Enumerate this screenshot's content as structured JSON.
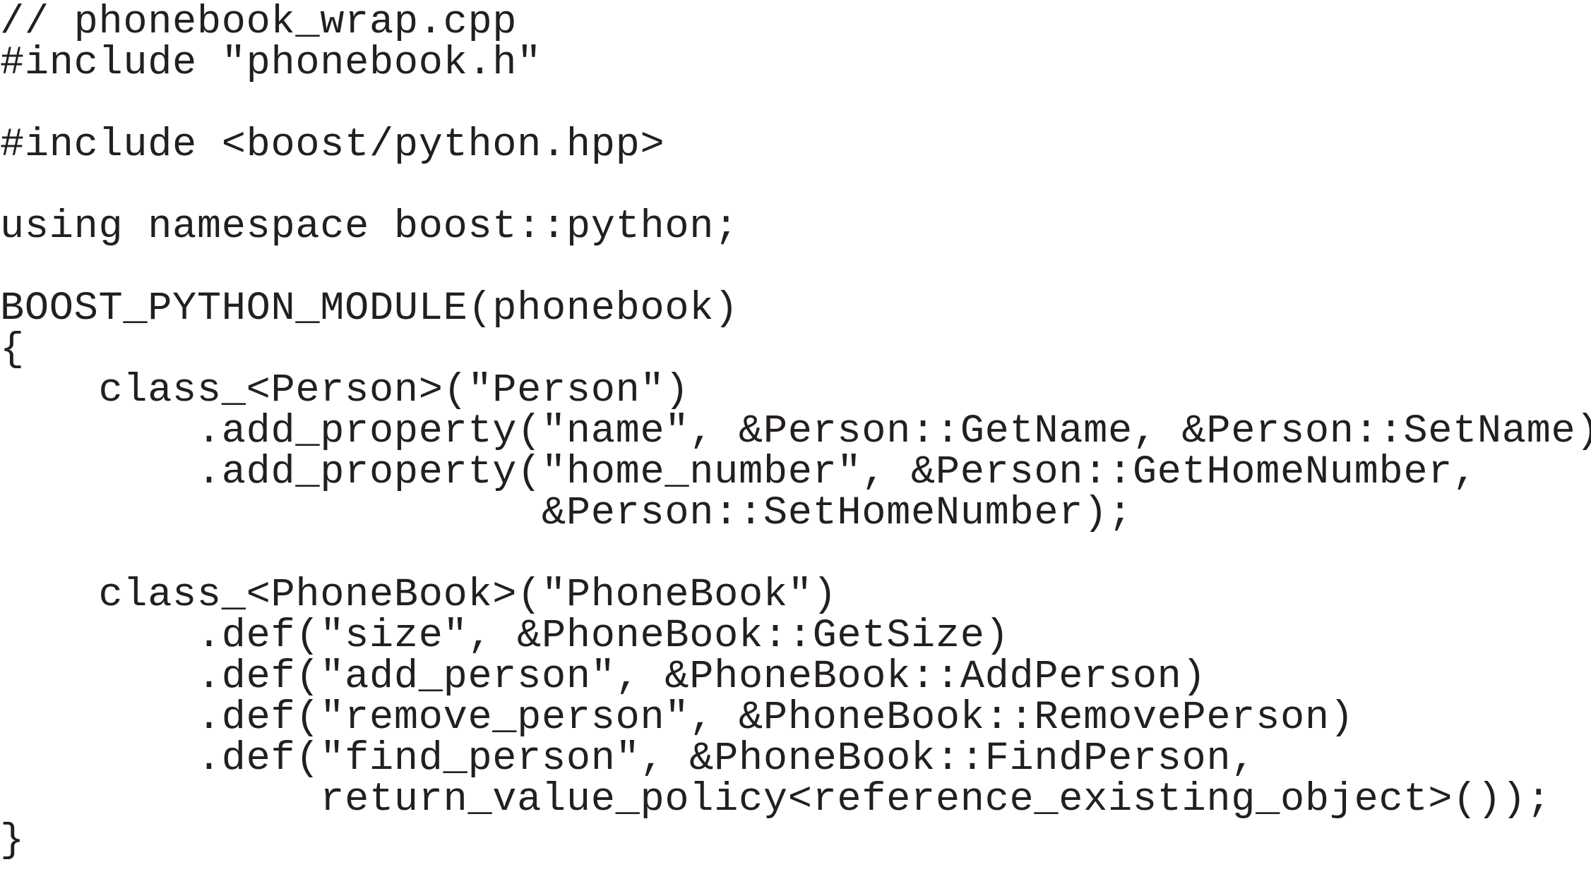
{
  "document": {
    "type": "source-code-listing",
    "language": "C++",
    "text_color": "#231f20",
    "background_color": "#ffffff",
    "lines": [
      "// phonebook_wrap.cpp",
      "#include \"phonebook.h\"",
      "",
      "#include <boost/python.hpp>",
      "",
      "using namespace boost::python;",
      "",
      "BOOST_PYTHON_MODULE(phonebook)",
      "{",
      "    class_<Person>(\"Person\")",
      "        .add_property(\"name\", &Person::GetName, &Person::SetName)",
      "        .add_property(\"home_number\", &Person::GetHomeNumber,",
      "                      &Person::SetHomeNumber);",
      "",
      "    class_<PhoneBook>(\"PhoneBook\")",
      "        .def(\"size\", &PhoneBook::GetSize)",
      "        .def(\"add_person\", &PhoneBook::AddPerson)",
      "        .def(\"remove_person\", &PhoneBook::RemovePerson)",
      "        .def(\"find_person\", &PhoneBook::FindPerson,",
      "             return_value_policy<reference_existing_object>());",
      "}"
    ]
  }
}
